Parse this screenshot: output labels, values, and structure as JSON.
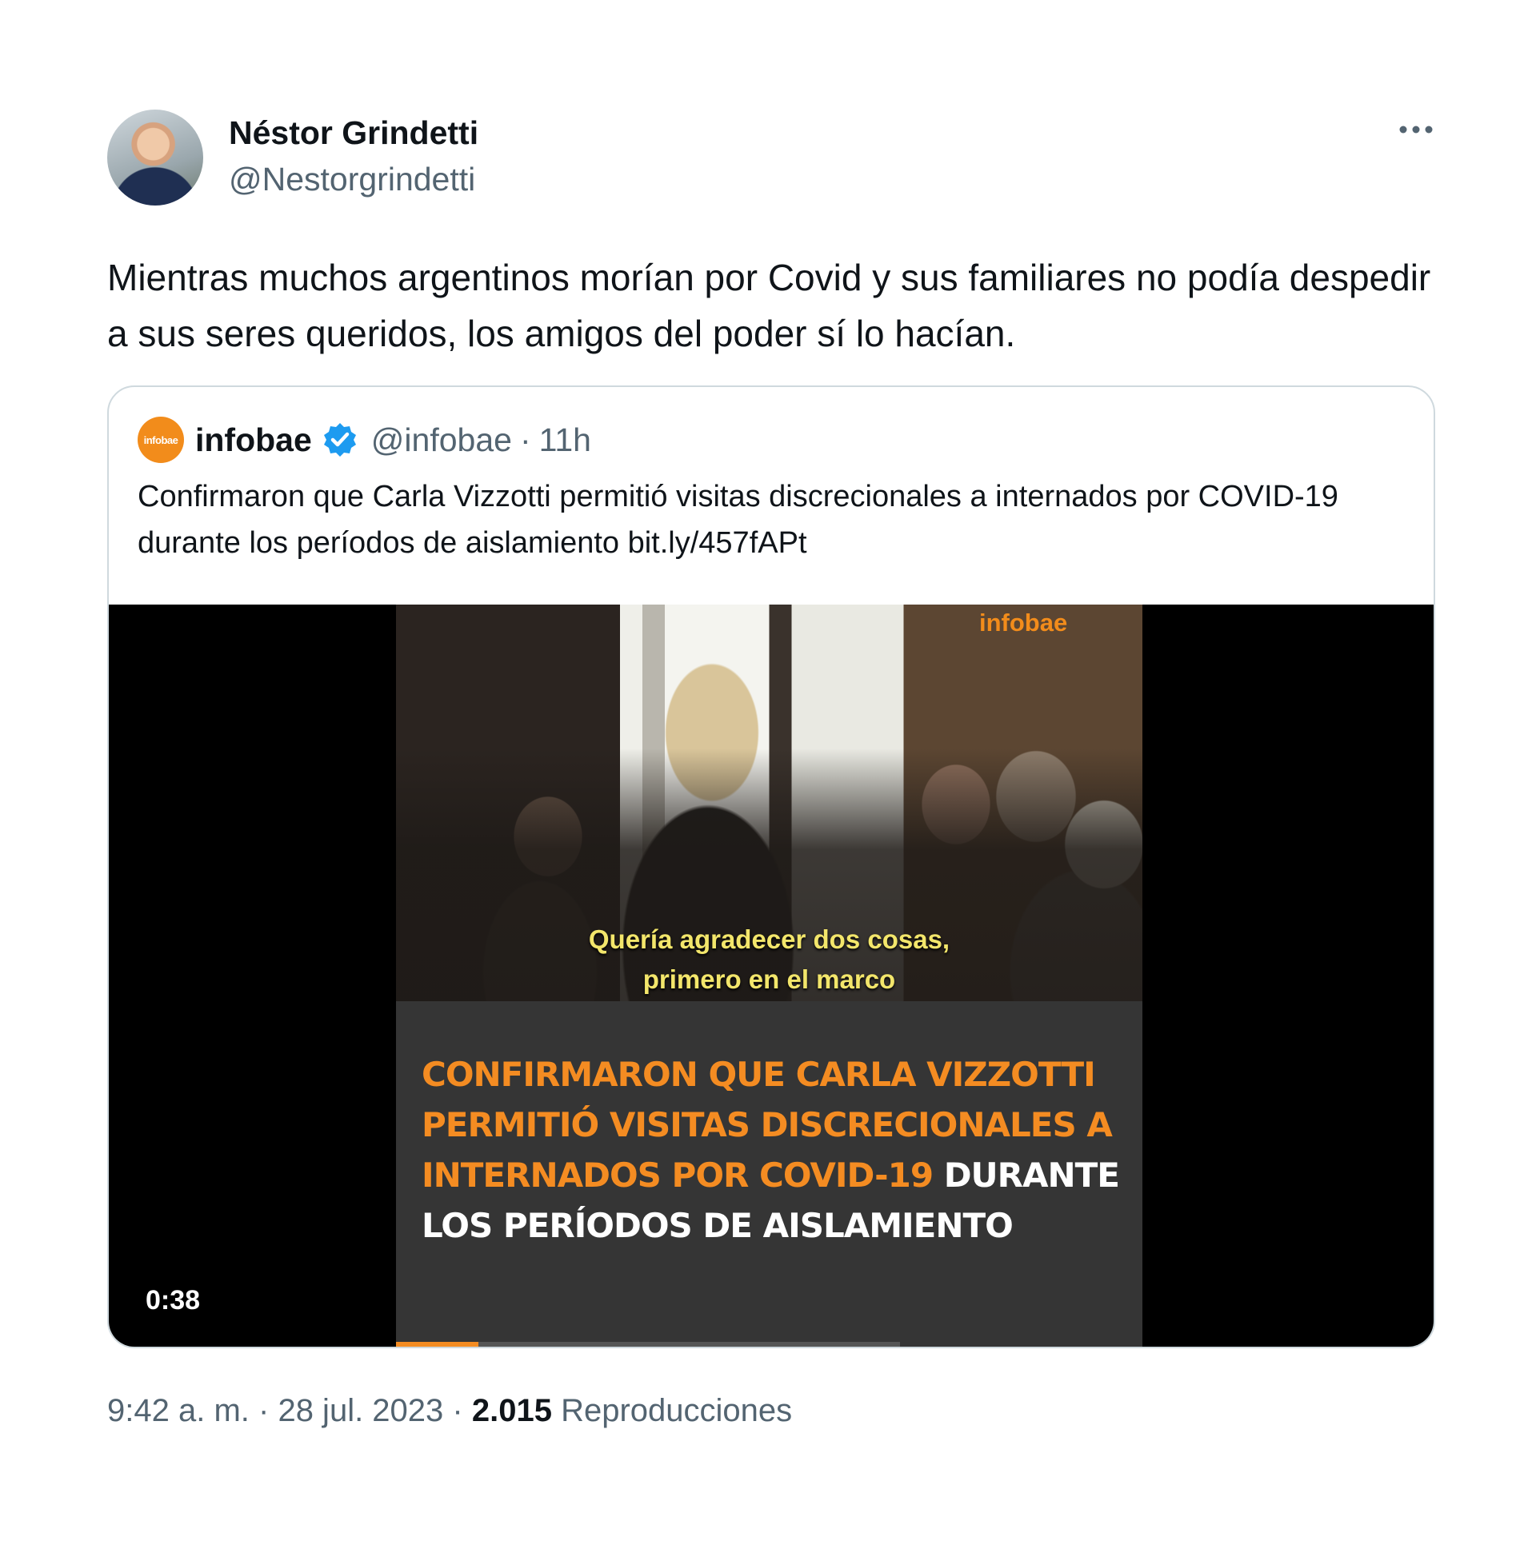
{
  "author": {
    "name": "Néstor Grindetti",
    "handle": "@Nestorgrindetti",
    "avatar_icon": "profile-photo"
  },
  "tweet": {
    "text": "Mientras muchos argentinos morían por Covid y sus familiares no podía despedir a sus seres queridos, los amigos del poder sí lo hacían."
  },
  "quoted": {
    "logo_text": "infobae",
    "name": "infobae",
    "verified": true,
    "handle": "@infobae",
    "separator": "·",
    "time": "11h",
    "text": "Confirmaron que Carla Vizzotti permitió visitas discrecionales a internados por COVID-19 durante los períodos de aislamiento bit.ly/457fAPt"
  },
  "video": {
    "watermark": "infobae",
    "subtitle_line1": "Quería agradecer dos cosas,",
    "subtitle_line2": "primero en el marco",
    "headline_orange": "CONFIRMARON QUE CARLA VIZZOTTI PERMITIÓ VISITAS DISCRECIONALES A INTERNADOS POR COVID-19",
    "headline_white": "DURANTE LOS PERÍODOS DE AISLAMIENTO",
    "duration": "0:38",
    "progress_fraction": 0.11,
    "accent_color": "#f48c22"
  },
  "footer": {
    "time": "9:42 a. m.",
    "sep1": "·",
    "date": "28 jul. 2023",
    "sep2": "·",
    "views_count": "2.015",
    "views_label": "Reproducciones"
  }
}
